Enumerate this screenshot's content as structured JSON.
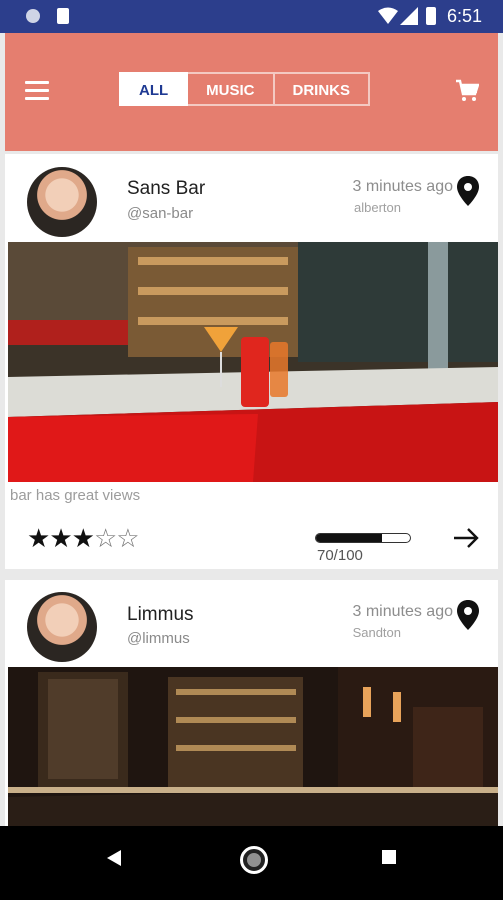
{
  "status_bar": {
    "time": "6:51"
  },
  "app_bar": {
    "tabs": [
      {
        "label": "ALL",
        "active": true
      },
      {
        "label": "MUSIC",
        "active": false
      },
      {
        "label": "DRINKS",
        "active": false
      }
    ],
    "menu_icon": "hamburger-menu-icon",
    "cart_icon": "shopping-cart-icon"
  },
  "posts": [
    {
      "name": "Sans Bar",
      "handle": "@san-bar",
      "time_ago": "3 minutes ago",
      "location": "alberton",
      "caption": "bar has great views",
      "rating": 3,
      "rating_max": 5,
      "progress": 0.7,
      "score_label": "70/100"
    },
    {
      "name": "Limmus",
      "handle": "@limmus",
      "time_ago": "3 minutes ago",
      "location": "Sandton"
    }
  ],
  "colors": {
    "status_bar": "#2c3e8c",
    "app_bar": "#e57e6f",
    "tab_active_text": "#1f3a93"
  }
}
